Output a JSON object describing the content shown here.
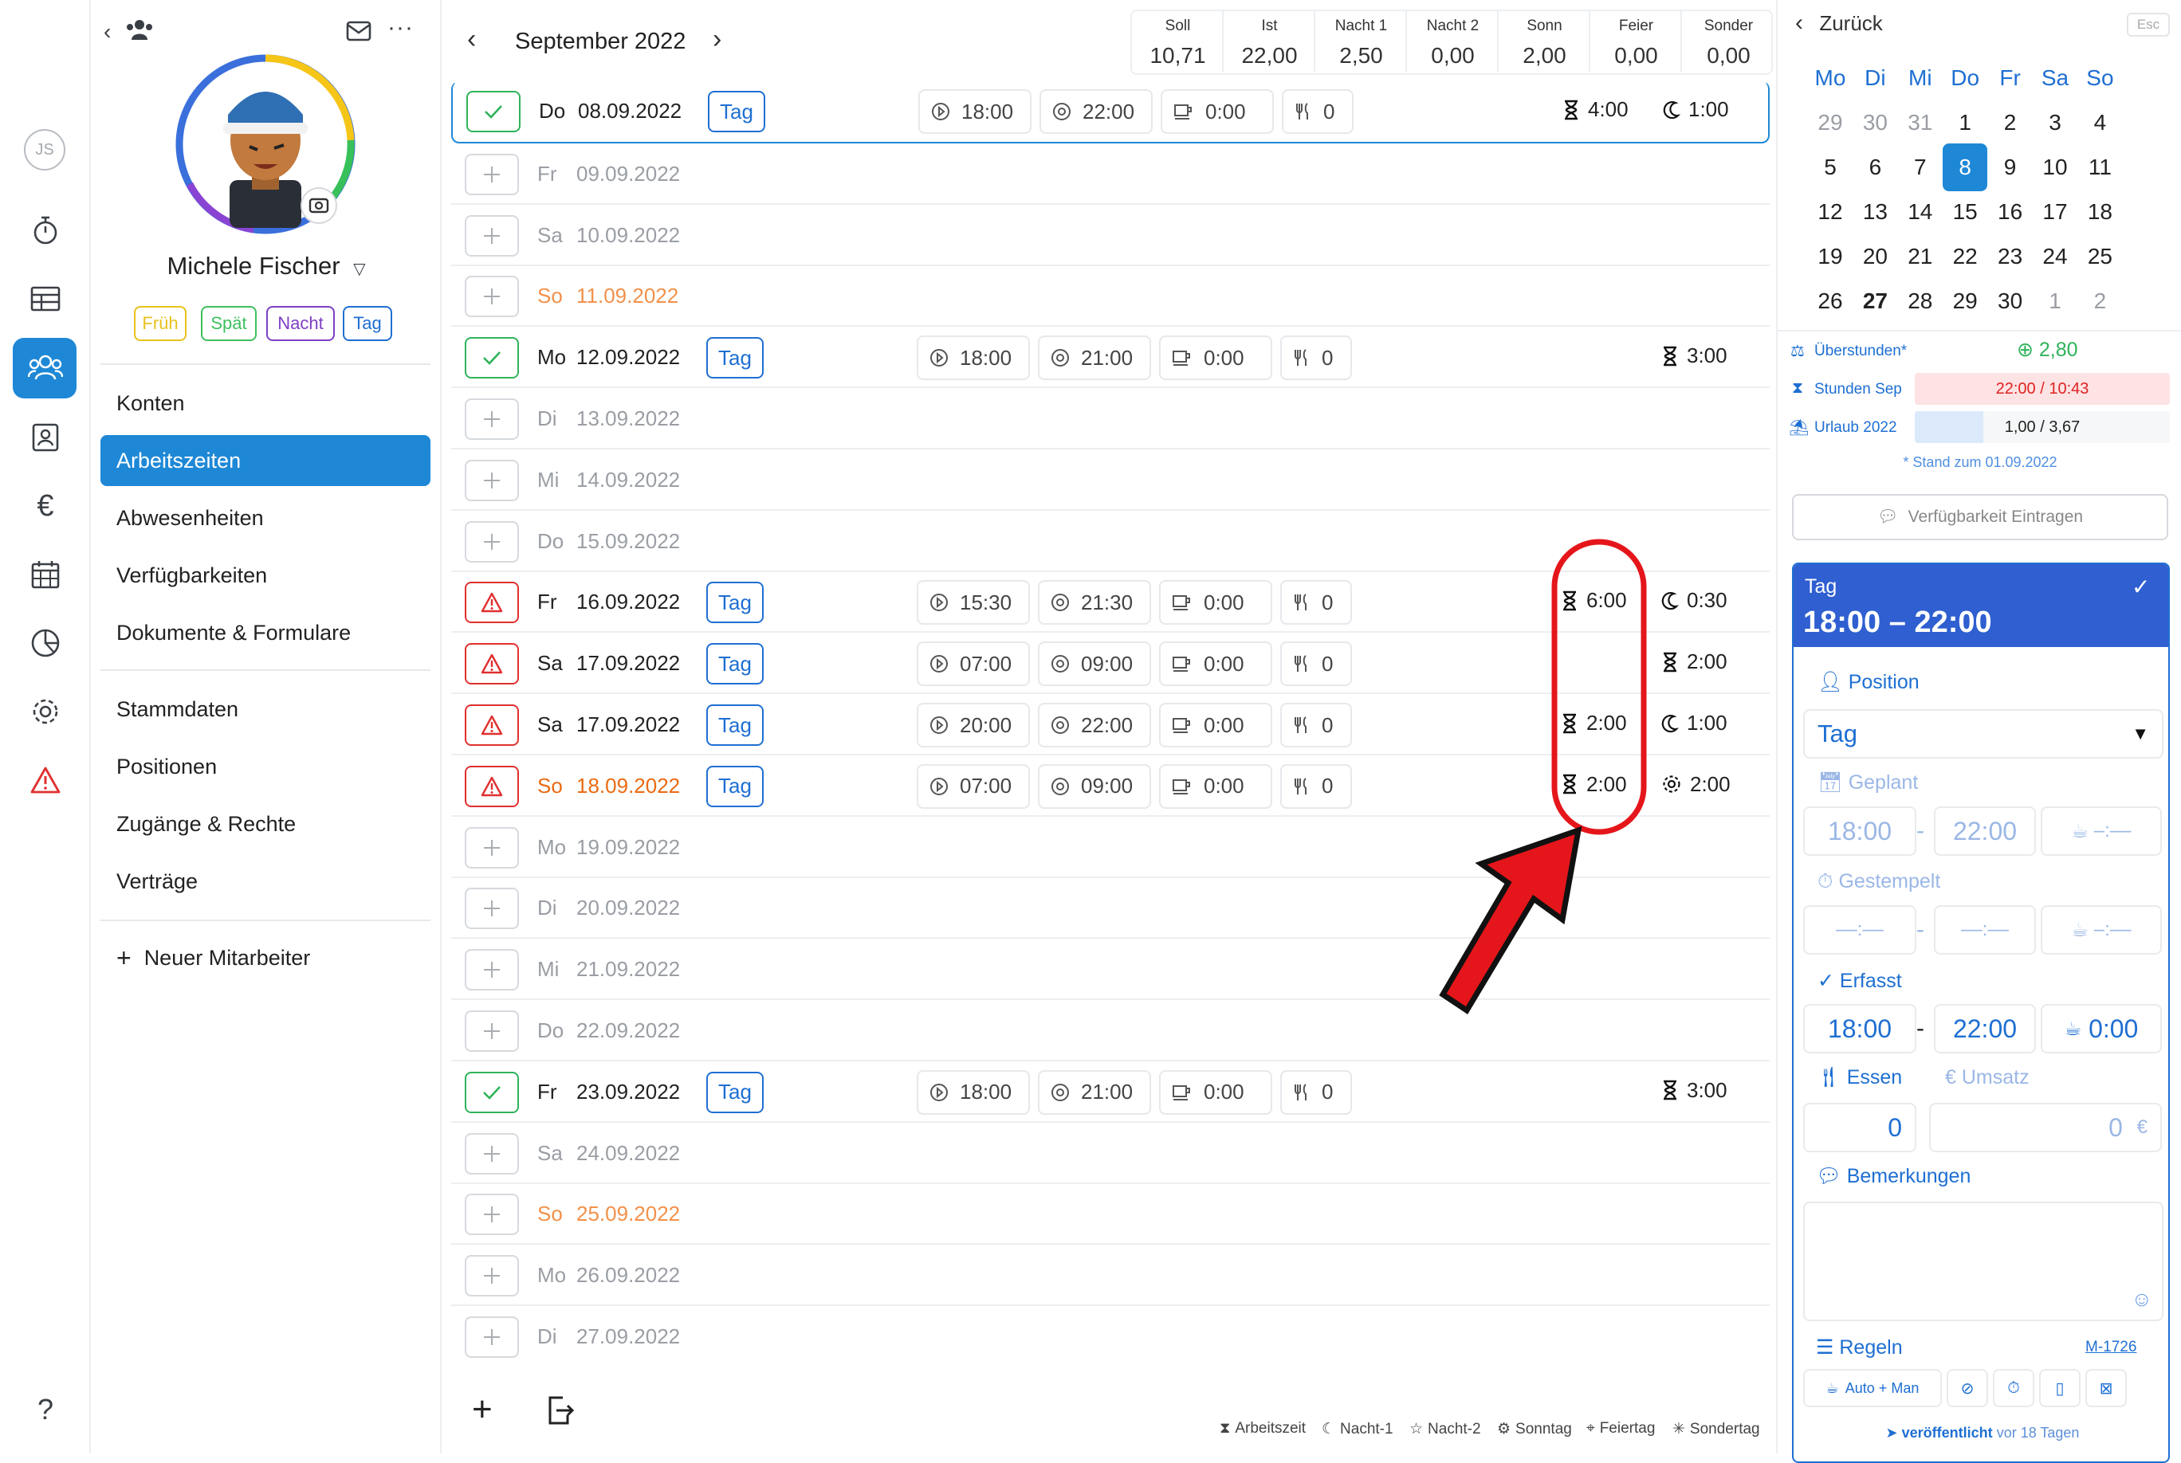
{
  "rail": {
    "user_initials": "JS"
  },
  "profile": {
    "name": "Michele Fischer",
    "shift_tags": [
      {
        "label": "Früh",
        "color": "#e8c11c"
      },
      {
        "label": "Spät",
        "color": "#3fbf5f"
      },
      {
        "label": "Nacht",
        "color": "#7e3fc4"
      },
      {
        "label": "Tag",
        "color": "#1e6fd2"
      }
    ]
  },
  "menu": {
    "konten": "Konten",
    "arbeitszeiten": "Arbeitszeiten",
    "abwesenheiten": "Abwesenheiten",
    "verfuegbarkeiten": "Verfügbarkeiten",
    "dokumente": "Dokumente & Formulare",
    "stammdaten": "Stammdaten",
    "positionen": "Positionen",
    "zugaenge": "Zugänge & Rechte",
    "vertraege": "Verträge",
    "neuer": "Neuer Mitarbeiter"
  },
  "header": {
    "month": "September 2022"
  },
  "summary": [
    {
      "label": "Soll",
      "value": "10,71"
    },
    {
      "label": "Ist",
      "value": "22,00"
    },
    {
      "label": "Nacht 1",
      "value": "2,50"
    },
    {
      "label": "Nacht 2",
      "value": "0,00"
    },
    {
      "label": "Sonn",
      "value": "2,00"
    },
    {
      "label": "Feier",
      "value": "0,00"
    },
    {
      "label": "Sonder",
      "value": "0,00"
    }
  ],
  "rows": [
    {
      "wd": "Do",
      "date": "08.09.2022",
      "status": "ok",
      "tag": "Tag",
      "start": "18:00",
      "end": "22:00",
      "pause": "0:00",
      "food": "0",
      "hours": "4:00",
      "extra_icon": "moon",
      "extra": "1:00",
      "sel": true
    },
    {
      "wd": "Fr",
      "date": "09.09.2022",
      "status": "empty"
    },
    {
      "wd": "Sa",
      "date": "10.09.2022",
      "status": "empty"
    },
    {
      "wd": "So",
      "date": "11.09.2022",
      "status": "empty",
      "sunday": true
    },
    {
      "wd": "Mo",
      "date": "12.09.2022",
      "status": "ok",
      "tag": "Tag",
      "start": "18:00",
      "end": "21:00",
      "pause": "0:00",
      "food": "0",
      "extra_icon": "hourglass",
      "extra": "3:00"
    },
    {
      "wd": "Di",
      "date": "13.09.2022",
      "status": "empty"
    },
    {
      "wd": "Mi",
      "date": "14.09.2022",
      "status": "empty"
    },
    {
      "wd": "Do",
      "date": "15.09.2022",
      "status": "empty"
    },
    {
      "wd": "Fr",
      "date": "16.09.2022",
      "status": "warn",
      "tag": "Tag",
      "start": "15:30",
      "end": "21:30",
      "pause": "0:00",
      "food": "0",
      "hours": "6:00",
      "extra_icon": "moon",
      "extra": "0:30"
    },
    {
      "wd": "Sa",
      "date": "17.09.2022",
      "status": "warn",
      "tag": "Tag",
      "start": "07:00",
      "end": "09:00",
      "pause": "0:00",
      "food": "0",
      "extra_icon": "hourglass",
      "extra": "2:00"
    },
    {
      "wd": "Sa",
      "date": "17.09.2022",
      "status": "warn",
      "tag": "Tag",
      "start": "20:00",
      "end": "22:00",
      "pause": "0:00",
      "food": "0",
      "hours": "2:00",
      "extra_icon": "moon",
      "extra": "1:00"
    },
    {
      "wd": "So",
      "date": "18.09.2022",
      "status": "warn",
      "tag": "Tag",
      "start": "07:00",
      "end": "09:00",
      "pause": "0:00",
      "food": "0",
      "hours": "2:00",
      "extra_icon": "gear",
      "extra": "2:00",
      "sunday_strong": true
    },
    {
      "wd": "Mo",
      "date": "19.09.2022",
      "status": "empty"
    },
    {
      "wd": "Di",
      "date": "20.09.2022",
      "status": "empty"
    },
    {
      "wd": "Mi",
      "date": "21.09.2022",
      "status": "empty"
    },
    {
      "wd": "Do",
      "date": "22.09.2022",
      "status": "empty"
    },
    {
      "wd": "Fr",
      "date": "23.09.2022",
      "status": "ok",
      "tag": "Tag",
      "start": "18:00",
      "end": "21:00",
      "pause": "0:00",
      "food": "0",
      "extra_icon": "hourglass",
      "extra": "3:00"
    },
    {
      "wd": "Sa",
      "date": "24.09.2022",
      "status": "empty"
    },
    {
      "wd": "So",
      "date": "25.09.2022",
      "status": "empty",
      "sunday": true
    },
    {
      "wd": "Mo",
      "date": "26.09.2022",
      "status": "empty"
    },
    {
      "wd": "Di",
      "date": "27.09.2022",
      "status": "empty"
    }
  ],
  "legend": [
    "Arbeitszeit",
    "Nacht-1",
    "Nacht-2",
    "Sonntag",
    "Feiertag",
    "Sondertag"
  ],
  "right": {
    "back": "Zurück",
    "esc": "Esc",
    "weekdays": [
      "Mo",
      "Di",
      "Mi",
      "Do",
      "Fr",
      "Sa",
      "So"
    ],
    "weeks": [
      [
        "29",
        "30",
        "31",
        "1",
        "2",
        "3",
        "4"
      ],
      [
        "5",
        "6",
        "7",
        "8",
        "9",
        "10",
        "11"
      ],
      [
        "12",
        "13",
        "14",
        "15",
        "16",
        "17",
        "18"
      ],
      [
        "19",
        "20",
        "21",
        "22",
        "23",
        "24",
        "25"
      ],
      [
        "26",
        "27",
        "28",
        "29",
        "30",
        "1",
        "2"
      ]
    ],
    "selected_day": "8",
    "today": "27",
    "overtime_label": "Überstunden*",
    "overtime_value": "2,80",
    "hours_label": "Stunden Sep",
    "hours_value": "22:00 / 10:43",
    "vacation_label": "Urlaub 2022",
    "vacation_value": "1,00 / 3,67",
    "vacation_fraction": 0.27,
    "stand_note": "* Stand zum 01.09.2022",
    "availability_btn": "Verfügbarkeit Eintragen",
    "card_title": "Tag",
    "card_time": "18:00 – 22:00",
    "position_label": "Position",
    "position_value": "Tag",
    "geplant_label": "Geplant",
    "geplant_start": "18:00",
    "geplant_end": "22:00",
    "geplant_pause": "–:––",
    "gestempelt_label": "Gestempelt",
    "gestempelt_start": "––:––",
    "gestempelt_end": "––:––",
    "gestempelt_pause": "–:––",
    "erfasst_label": "Erfasst",
    "erfasst_start": "18:00",
    "erfasst_end": "22:00",
    "erfasst_pause": "0:00",
    "essen_label": "Essen",
    "umsatz_label": "Umsatz",
    "essen_value": "0",
    "umsatz_value": "0",
    "currency": "€",
    "bemerkungen_label": "Bemerkungen",
    "regeln_label": "Regeln",
    "regeln_code": "M-1726",
    "auto_man": "Auto + Man",
    "published_label": "veröffentlicht",
    "published_time": "vor 18 Tagen"
  },
  "colors": {
    "accent": "#1e88d7",
    "blue": "#1e6fd2",
    "ok": "#2fb35a",
    "warn": "#e0302f",
    "sunday": "#f2914a",
    "annotation": "#e5161b"
  }
}
